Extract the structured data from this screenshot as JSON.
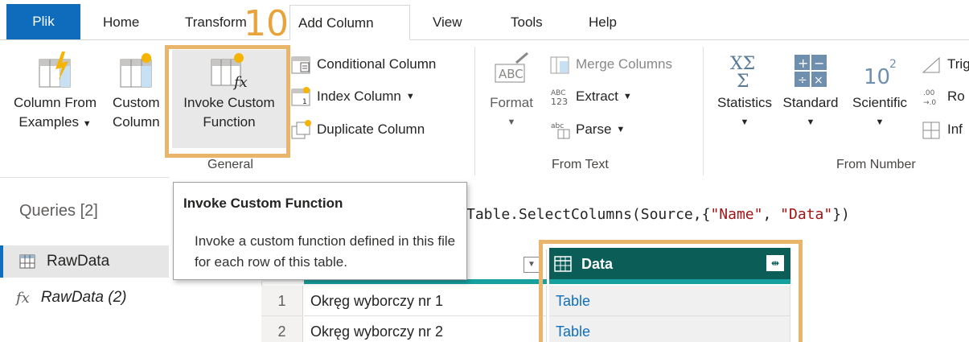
{
  "tabs": {
    "file": "Plik",
    "home": "Home",
    "transform": "Transform",
    "add_column": "Add Column",
    "view": "View",
    "tools": "Tools",
    "help": "Help"
  },
  "step_number": "10",
  "ribbon": {
    "general": {
      "label": "General",
      "column_from_examples": [
        "Column From",
        "Examples"
      ],
      "custom_column": [
        "Custom",
        "Column"
      ],
      "invoke_custom_function": [
        "Invoke Custom",
        "Function"
      ],
      "conditional_column": "Conditional Column",
      "index_column": "Index Column",
      "duplicate_column": "Duplicate Column"
    },
    "from_text": {
      "label": "From Text",
      "format": "Format",
      "merge_columns": "Merge Columns",
      "extract": "Extract",
      "parse": "Parse"
    },
    "from_number": {
      "label": "From Number",
      "statistics": "Statistics",
      "standard": "Standard",
      "scientific": "Scientific",
      "trig_partial": "Trig",
      "rounding_partial": "Ro",
      "info_partial": "Inf"
    }
  },
  "tooltip": {
    "title": "Invoke Custom Function",
    "body": "Invoke a custom function defined in this file for each row of this table."
  },
  "queries": {
    "title": "Queries [2]",
    "items": [
      {
        "label": "RawData"
      },
      {
        "label": "RawData (2)"
      }
    ]
  },
  "formula": {
    "prefix": "Table.SelectColumns(Source,{",
    "str1": "\"Name\"",
    "sep": ", ",
    "str2": "\"Data\"",
    "suffix": "})"
  },
  "table": {
    "data_header": "Data",
    "rows": [
      {
        "num": "1",
        "name": "Okręg wyborczy nr 1",
        "data": "Table"
      },
      {
        "num": "2",
        "name": "Okręg wyborczy nr 2",
        "data": "Table"
      }
    ]
  },
  "colors": {
    "file_tab": "#0f6cbd",
    "highlight": "#e8b56a",
    "data_header": "#0b5e57",
    "teal_strip": "#17a0a0",
    "table_link": "#106ebe"
  }
}
